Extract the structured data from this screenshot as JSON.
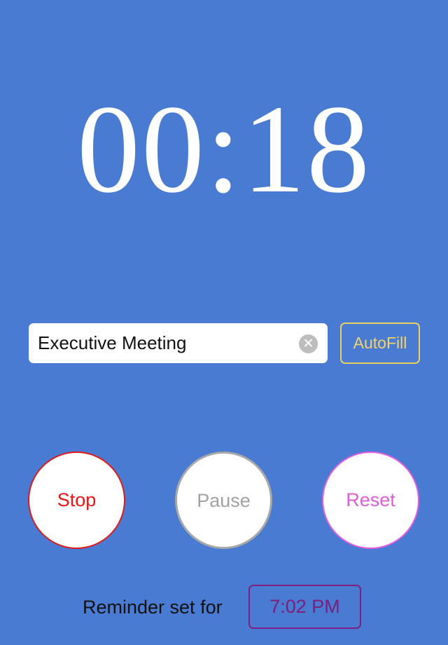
{
  "timer": {
    "display": "00:18"
  },
  "meeting": {
    "name_value": "Executive Meeting",
    "clear_icon": "clear-icon",
    "autofill_label": "AutoFill"
  },
  "controls": {
    "stop_label": "Stop",
    "pause_label": "Pause",
    "reset_label": "Reset"
  },
  "reminder": {
    "label": "Reminder set for",
    "time": "7:02 PM"
  },
  "colors": {
    "background": "#4a7bd2",
    "stop": "#ec1414",
    "pause": "#a2a2a2",
    "reset": "#df5ed8",
    "autofill": "#f2d36b",
    "reminder_time": "#7c1e7a"
  }
}
